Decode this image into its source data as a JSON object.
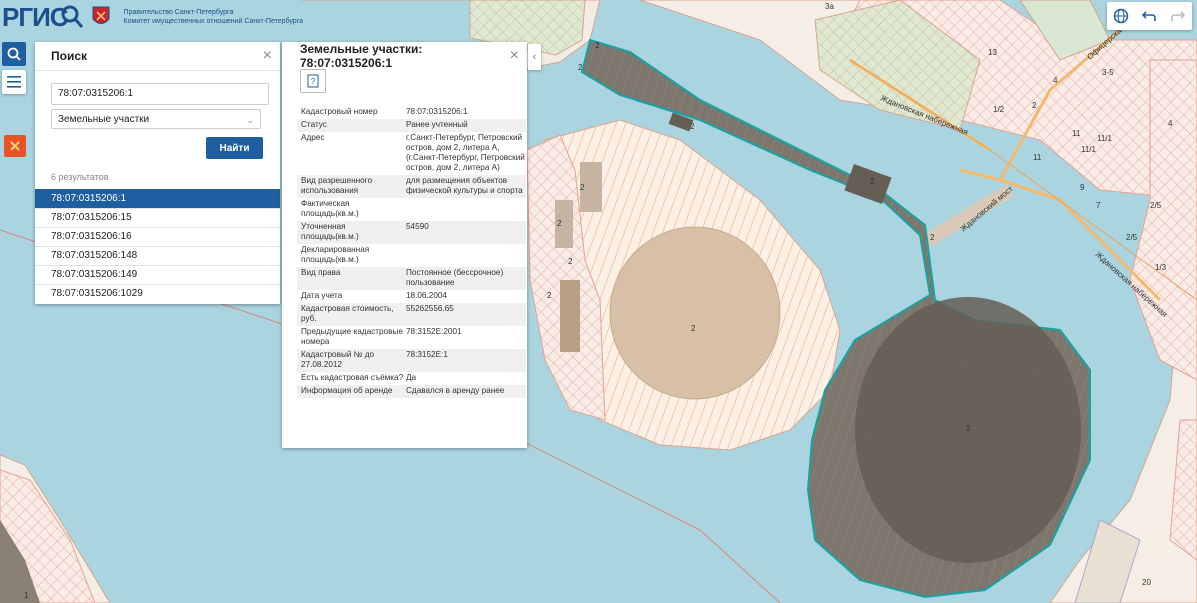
{
  "header": {
    "logo_text": "РГИС",
    "gov_line1": "Правительство Санкт-Петербурга",
    "gov_line2": "Комитет имущественных отношений Санкт-Петербурга"
  },
  "search": {
    "title": "Поиск",
    "query": "78:07:0315206:1",
    "type": "Земельные участки",
    "find_label": "Найти",
    "results_count": "6 результатов",
    "results": [
      "78:07:0315206:1",
      "78:07:0315206:15",
      "78:07:0315206:16",
      "78:07:0315206:148",
      "78:07:0315206:149",
      "78:07:0315206:1029"
    ]
  },
  "info": {
    "title": "Земельные участки: 78:07:0315206:1",
    "attributes": [
      {
        "k": "Кадастровый номер",
        "v": "78:07:0315206:1"
      },
      {
        "k": "Статус",
        "v": "Ранее учтенный"
      },
      {
        "k": "Адрес",
        "v": "г.Санкт-Петербург, Петровский остров, дом 2, литера А, (г.Санкт-Петербург, Петровский остров, дом 2, литера А)"
      },
      {
        "k": "Вид разрешенного использования",
        "v": "для размещения объектов физической культуры и спорта"
      },
      {
        "k": "Фактическая площадь(кв.м.)",
        "v": ""
      },
      {
        "k": "Уточненная площадь(кв.м.)",
        "v": "54590"
      },
      {
        "k": "Декларированная площадь(кв.м.)",
        "v": ""
      },
      {
        "k": "Вид права",
        "v": "Постоянное (бессрочное) пользование"
      },
      {
        "k": "Дата учета",
        "v": "18.06.2004"
      },
      {
        "k": "Кадастровая стоимость, руб.",
        "v": "55262556.65"
      },
      {
        "k": "Предыдущие кадастровые номера",
        "v": "78:3152Е:2001"
      },
      {
        "k": "Кадастровый № до 27.08.2012",
        "v": "78:3152Е:1"
      },
      {
        "k": "Есть кадастровая съёмка?",
        "v": "Да"
      },
      {
        "k": "Информация об аренде",
        "v": "Сдавался в аренду ранее"
      }
    ]
  },
  "map_labels": [
    "Ждановская набережная",
    "Ждановская набережная",
    "Ждановский мост",
    "Офицерская",
    "2",
    "2",
    "2",
    "2",
    "2",
    "2",
    "2",
    "2",
    "2",
    "2",
    "2",
    "2",
    "3а",
    "13",
    "4",
    "1/2",
    "3-5",
    "4",
    "11",
    "11/1",
    "11/1",
    "11",
    "9",
    "7",
    "2/5",
    "2/5",
    "1/3",
    "20",
    "1"
  ],
  "colors": {
    "water": "#aad5e0",
    "accent": "#1f5ea0",
    "parcel": "#747068",
    "outline": "#16a3a3",
    "hatch": "#e8a08e"
  }
}
